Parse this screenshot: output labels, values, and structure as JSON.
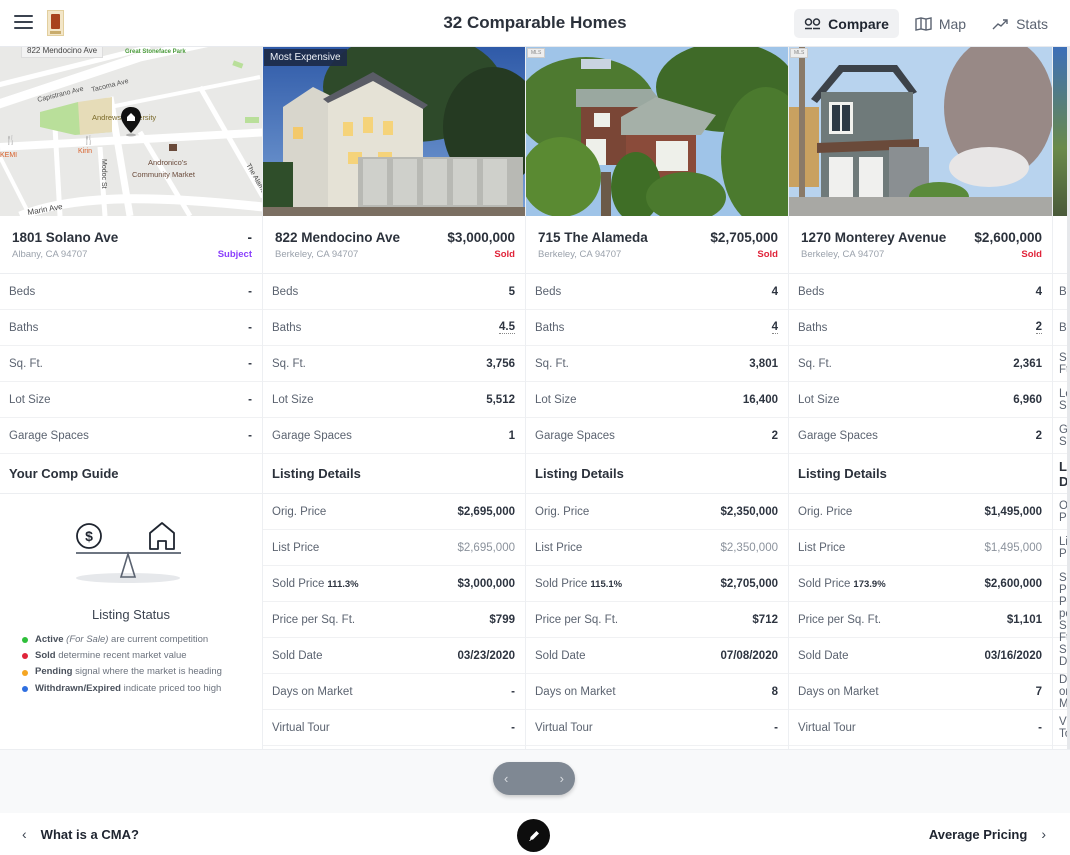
{
  "header": {
    "title": "32 Comparable Homes",
    "nav": [
      {
        "label": "Compare",
        "icon": "compare-icon",
        "active": true
      },
      {
        "label": "Map",
        "icon": "map-icon",
        "active": false
      },
      {
        "label": "Stats",
        "icon": "trend-icon",
        "active": false
      }
    ]
  },
  "map": {
    "tooltip": "822 Mendocino Ave",
    "labels": {
      "park": "Great Stoneface Park",
      "street1": "Capistrano Ave",
      "street2": "Tacoma Ave",
      "school": "Andrews University",
      "rest1": "KEMI",
      "rest2": "Kirin",
      "street3": "Modoc St",
      "market1": "Andronico's",
      "market2": "Community Market",
      "street4": "Marin Ave",
      "street5": "The Alameda"
    }
  },
  "row_labels": {
    "beds": "Beds",
    "baths": "Baths",
    "sqft": "Sq. Ft.",
    "lot": "Lot Size",
    "garage": "Garage Spaces",
    "orig": "Orig. Price",
    "list": "List Price",
    "sold": "Sold Price",
    "ppsf": "Price per Sq. Ft.",
    "sold_date": "Sold Date",
    "dom": "Days on Market",
    "tour": "Virtual Tour"
  },
  "subject": {
    "address": "1801 Solano Ave",
    "city": "Albany, CA 94707",
    "price": "-",
    "status": "Subject",
    "status_color": "#8a3ffc",
    "beds": "-",
    "baths": "-",
    "sqft": "-",
    "lot": "-",
    "garage": "-",
    "guide_title": "Your Comp Guide",
    "listing_status_title": "Listing Status",
    "legend": [
      {
        "strong": "Active",
        "em": "(For Sale)",
        "text": "are current competition",
        "color": "#2fbf3a"
      },
      {
        "strong": "Sold",
        "em": "",
        "text": "determine recent market value",
        "color": "#e0243a"
      },
      {
        "strong": "Pending",
        "em": "",
        "text": "signal where the market is heading",
        "color": "#f5a623"
      },
      {
        "strong": "Withdrawn/Expired",
        "em": "",
        "text": "indicate priced too high",
        "color": "#2f6fe0"
      }
    ]
  },
  "section_title": "Listing Details",
  "comps": [
    {
      "badge": "Most Expensive",
      "address": "822 Mendocino Ave",
      "city": "Berkeley, CA 94707",
      "price": "$3,000,000",
      "status": "Sold",
      "status_color": "#e0243a",
      "beds": "5",
      "baths": "4.5",
      "sqft": "3,756",
      "lot": "5,512",
      "garage": "1",
      "orig": "$2,695,000",
      "list": "$2,695,000",
      "sold_pct": "111.3%",
      "sold": "$3,000,000",
      "ppsf": "$799",
      "sold_date": "03/23/2020",
      "dom": "-",
      "tour": "-"
    },
    {
      "badge": "",
      "address": "715 The Alameda",
      "city": "Berkeley, CA 94707",
      "price": "$2,705,000",
      "status": "Sold",
      "status_color": "#e0243a",
      "beds": "4",
      "baths": "4",
      "sqft": "3,801",
      "lot": "16,400",
      "garage": "2",
      "orig": "$2,350,000",
      "list": "$2,350,000",
      "sold_pct": "115.1%",
      "sold": "$2,705,000",
      "ppsf": "$712",
      "sold_date": "07/08/2020",
      "dom": "8",
      "tour": "-"
    },
    {
      "badge": "",
      "address": "1270 Monterey Avenue",
      "city": "Berkeley, CA 94707",
      "price": "$2,600,000",
      "status": "Sold",
      "status_color": "#e0243a",
      "beds": "4",
      "baths": "2",
      "sqft": "2,361",
      "lot": "6,960",
      "garage": "2",
      "orig": "$1,495,000",
      "list": "$1,495,000",
      "sold_pct": "173.9%",
      "sold": "$2,600,000",
      "ppsf": "$1,101",
      "sold_date": "03/16/2020",
      "dom": "7",
      "tour": "-"
    }
  ],
  "pager": {
    "prev": "‹",
    "next": "›"
  },
  "footer": {
    "prev_label": "What is a CMA?",
    "next_label": "Average Pricing",
    "chev_left": "‹",
    "chev_right": "›"
  }
}
